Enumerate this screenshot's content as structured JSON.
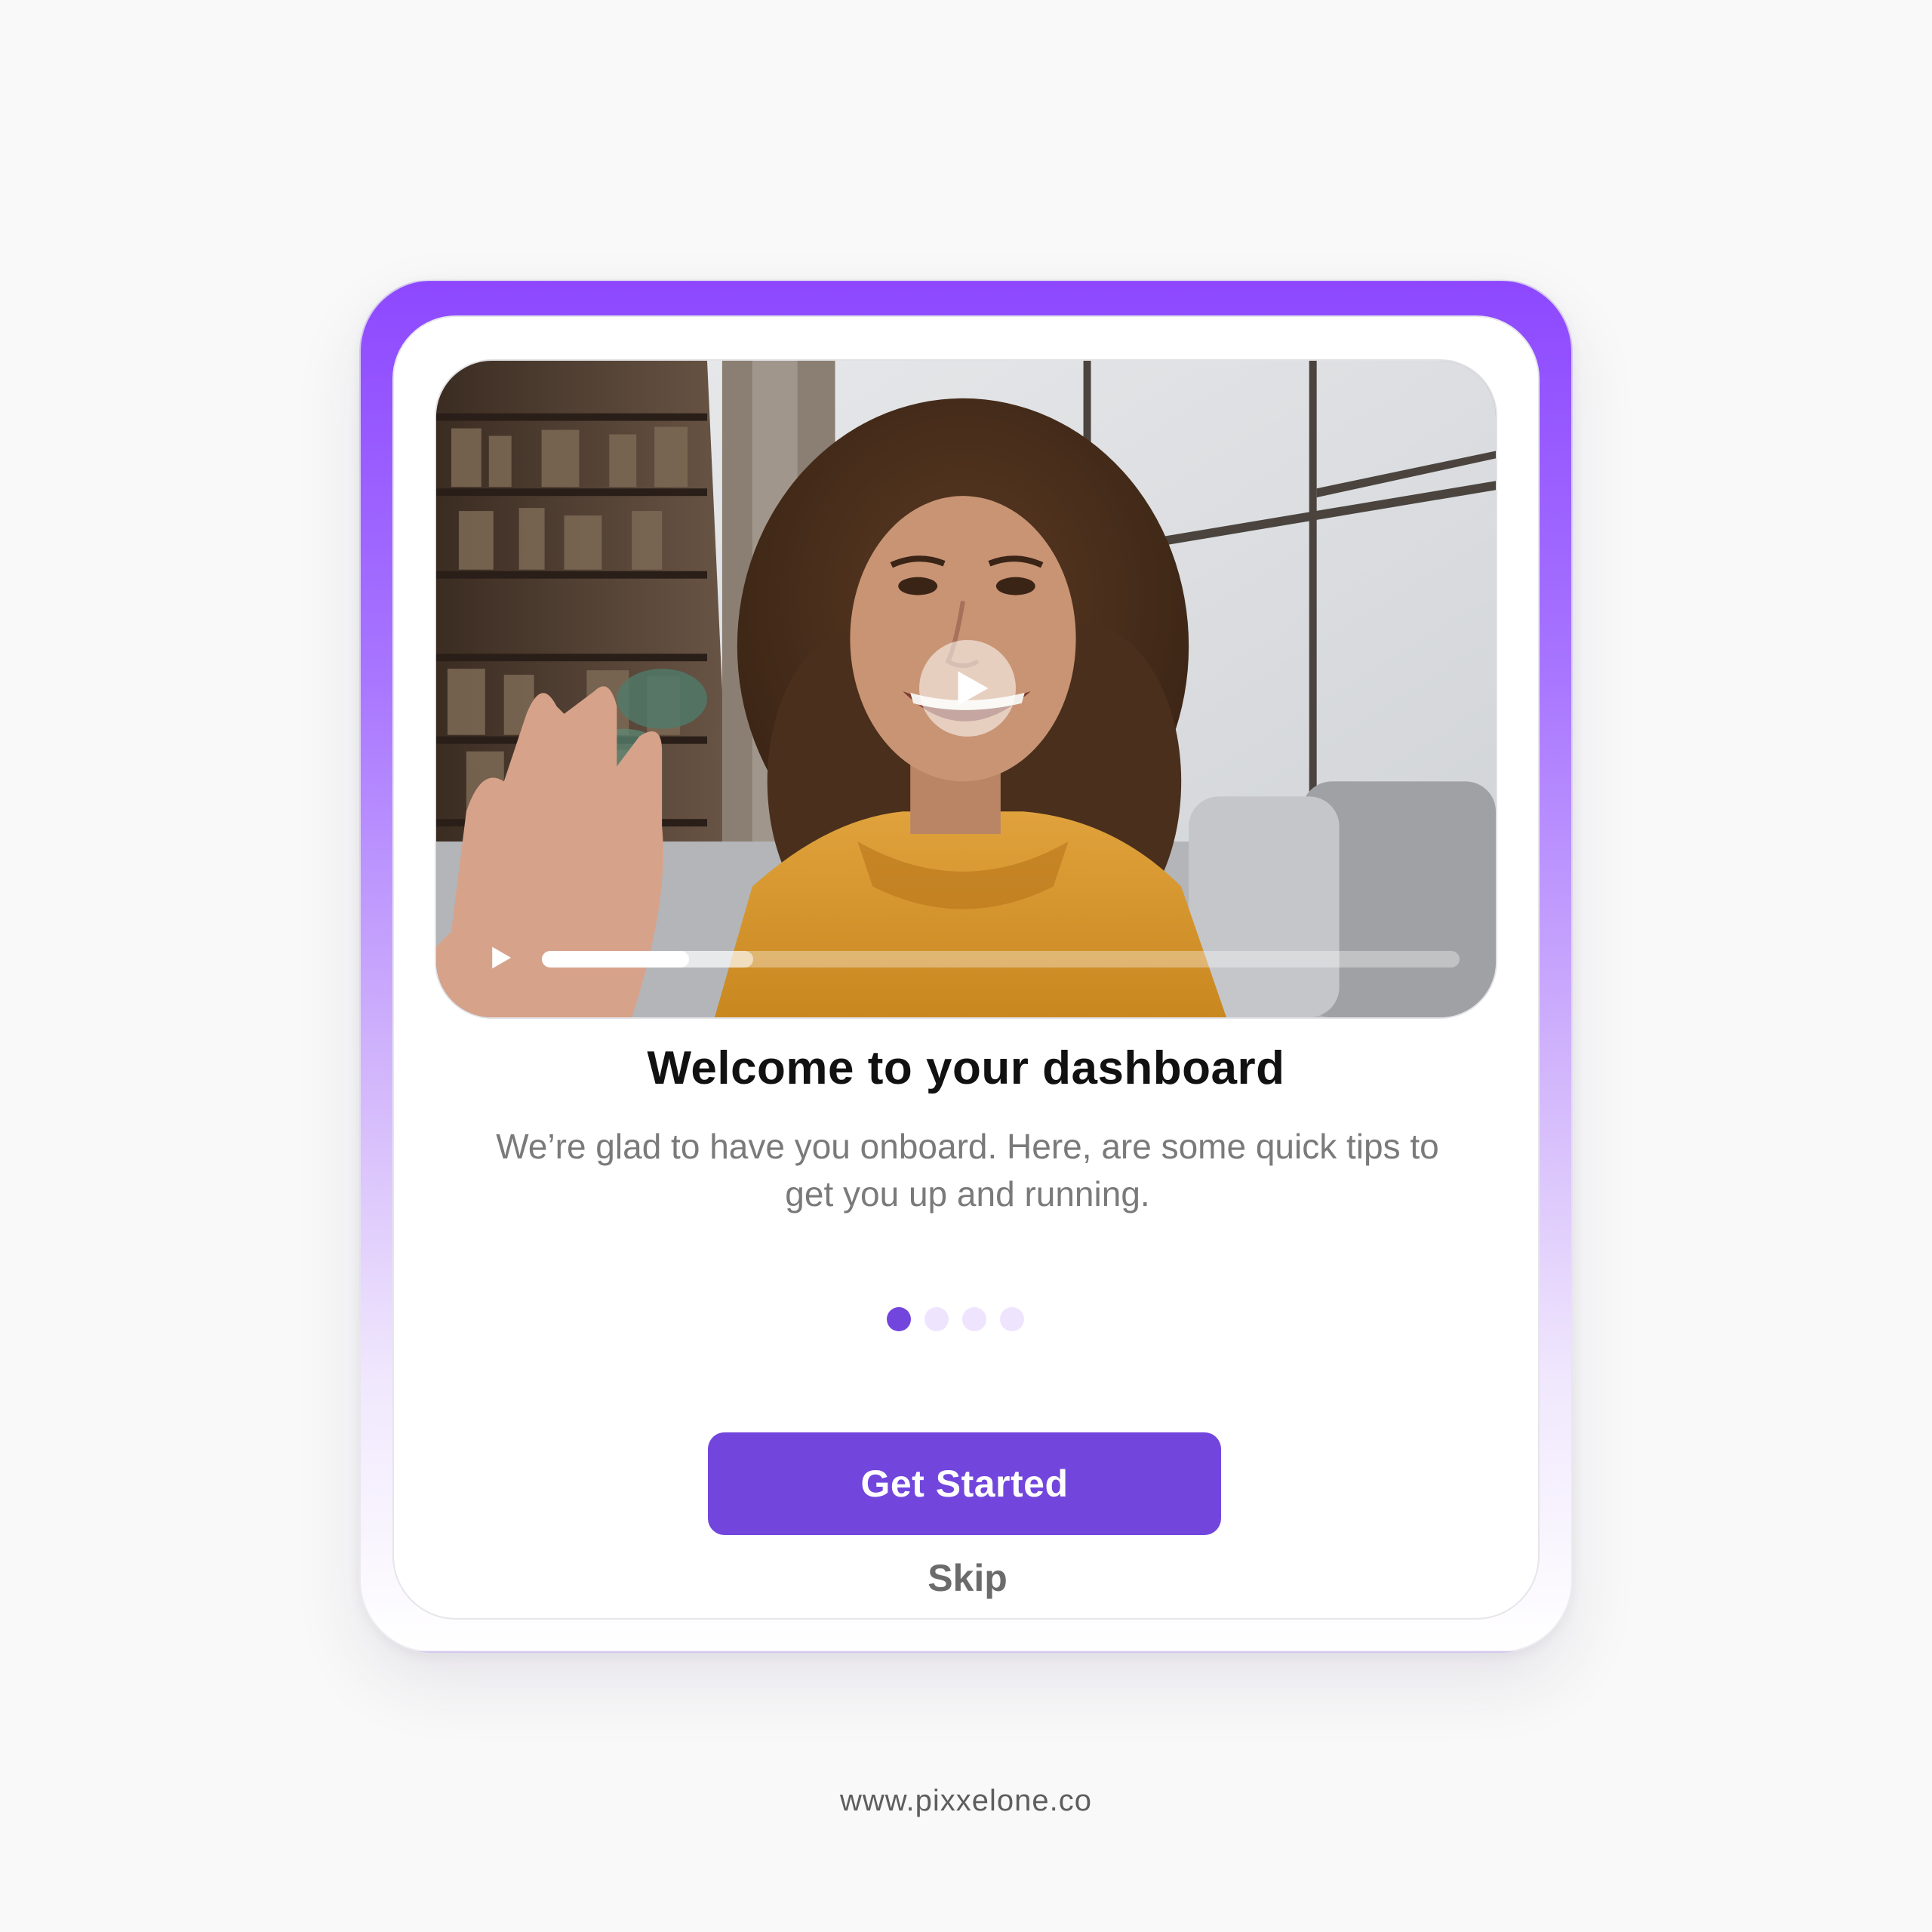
{
  "onboarding": {
    "title": "Welcome to your dashboard",
    "description": "We’re glad to have you onboard. Here, are some quick tips to get you up and running.",
    "pagination": {
      "total": 4,
      "current": 1
    },
    "primary_button_label": "Get Started",
    "skip_label": "Skip"
  },
  "video": {
    "progress_played": 0.16,
    "progress_buffered": 0.23,
    "icons": {
      "center": "play-icon",
      "control": "play-icon"
    }
  },
  "footer": {
    "url": "www.pixxelone.co"
  },
  "colors": {
    "accent": "#7246dd",
    "frame_top": "#8d48ff",
    "dot_inactive": "#efe4fd",
    "title": "#111111",
    "body_text": "#7a7a7a"
  }
}
